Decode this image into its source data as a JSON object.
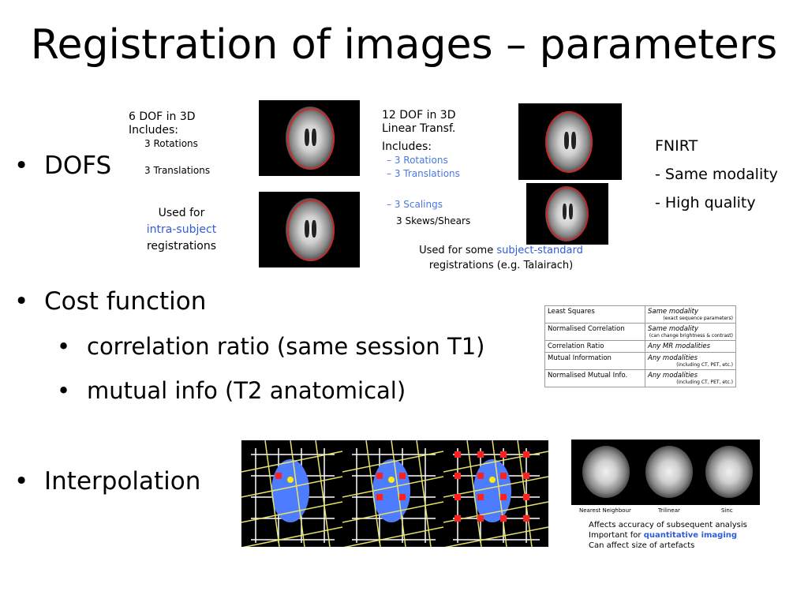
{
  "slide": {
    "title": "Registration of images – parameters"
  },
  "bullets": {
    "dofs": "DOFS",
    "cost": "Cost function",
    "cost_sub1": "correlation ratio (same session T1)",
    "cost_sub2": "mutual info (T2 anatomical)",
    "interp": "Interpolation"
  },
  "dof6": {
    "line1": "6 DOF in 3D",
    "line2": "Includes:",
    "line3": "3 Rotations",
    "line4": "3 Translations",
    "used_for": "Used for",
    "intra": "intra-subject",
    "registrations": "registrations"
  },
  "dof12": {
    "line1": "12 DOF in 3D",
    "line2": "Linear Transf.",
    "line3": "Includes:",
    "rot": "– 3 Rotations",
    "trans": "– 3 Translations",
    "scal": "– 3 Scalings",
    "skew": "3 Skews/Shears",
    "used_for": "Used for some",
    "subj": "subject-standard",
    "reg": "registrations (e.g. Talairach)"
  },
  "fnirt": {
    "title": "FNIRT",
    "line1": "- Same modality",
    "line2": "- High quality"
  },
  "cost_table": [
    {
      "name": "Least Squares",
      "desc": "Same modality",
      "note": "(exact sequence parameters)"
    },
    {
      "name": "Normalised Correlation",
      "desc": "Same modality",
      "note": "(can change brightness & contrast)"
    },
    {
      "name": "Correlation Ratio",
      "desc": "Any MR modalities",
      "note": ""
    },
    {
      "name": "Mutual Information",
      "desc": "Any modalities",
      "note": "(including CT, PET, etc.)"
    },
    {
      "name": "Normalised Mutual Info.",
      "desc": "Any modalities",
      "note": "(including CT, PET, etc.)"
    }
  ],
  "interp_panel": {
    "label1": "Nearest Neighbour",
    "label2": "Trilinear",
    "label3": "Sinc",
    "line1": "Affects accuracy of subsequent analysis",
    "line2_a": "Important for",
    "line2_b": "quantitative imaging",
    "line3": "Can affect size of artefacts"
  }
}
